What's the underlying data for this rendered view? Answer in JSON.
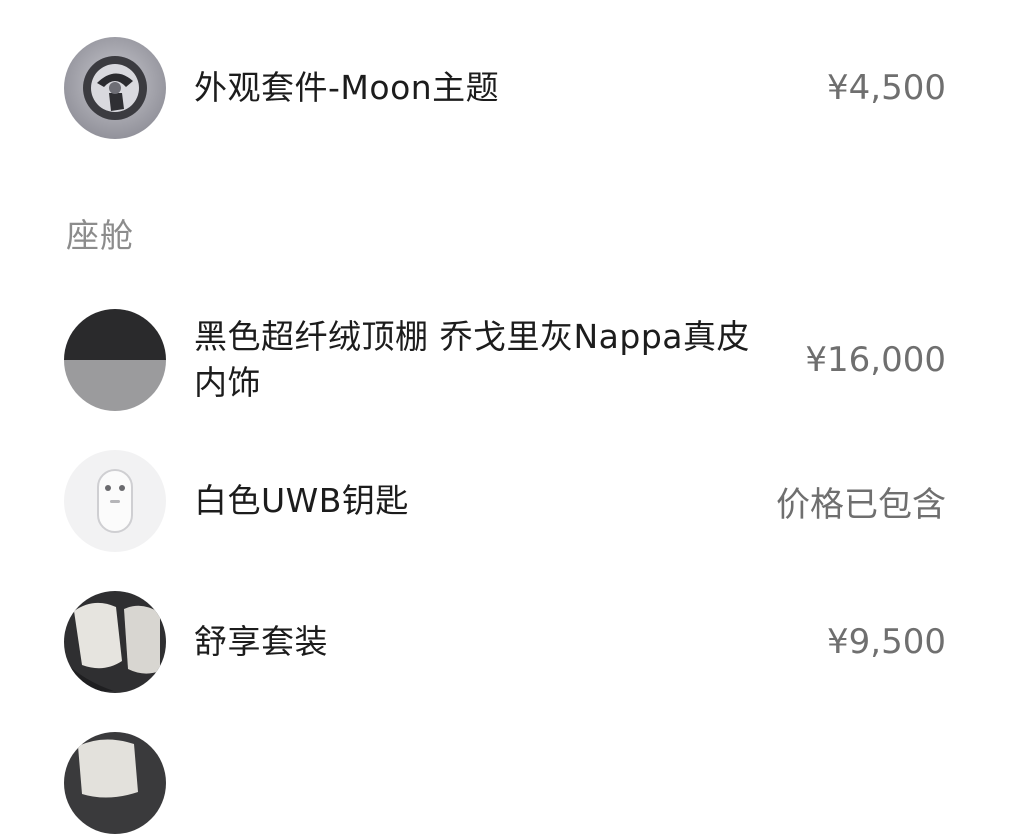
{
  "items_top": [
    {
      "name": "外观套件-Moon主题",
      "price": "¥4,500",
      "thumb_icon": "wheel-thumbnail"
    }
  ],
  "cabin": {
    "section_title": "座舱",
    "items": [
      {
        "name": "黑色超纤绒顶棚 乔戈里灰Nappa真皮内饰",
        "price": "¥16,000",
        "thumb_icon": "interior-color-swatch"
      },
      {
        "name": "白色UWB钥匙",
        "price": "价格已包含",
        "thumb_icon": "uwb-key-thumbnail"
      },
      {
        "name": "舒享套装",
        "price": "¥9,500",
        "thumb_icon": "seat-thumbnail"
      },
      {
        "name": "",
        "price": "",
        "thumb_icon": "seat-thumbnail-partial"
      }
    ]
  }
}
